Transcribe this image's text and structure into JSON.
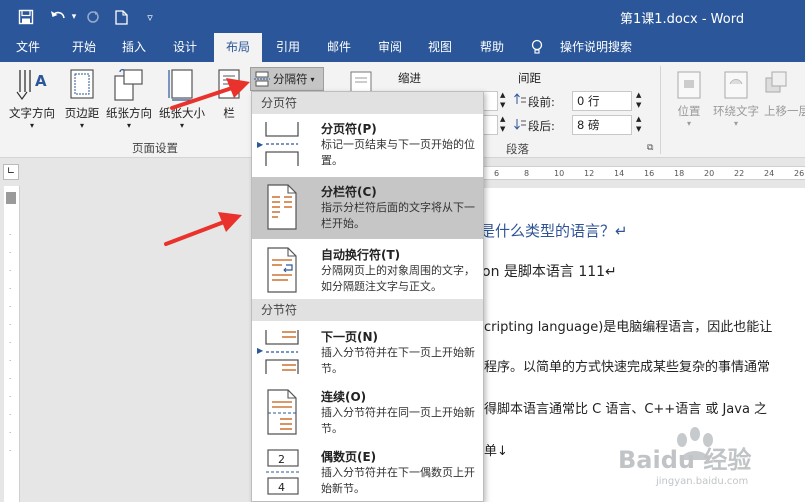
{
  "window": {
    "title": "第1课1.docx - Word"
  },
  "tabs": [
    "文件",
    "开始",
    "插入",
    "设计",
    "布局",
    "引用",
    "邮件",
    "审阅",
    "视图",
    "帮助",
    "操作说明搜索"
  ],
  "ribbon": {
    "page_setup": {
      "text_direction": "文字方向",
      "margins": "页边距",
      "orientation": "纸张方向",
      "size": "纸张大小",
      "columns": "栏",
      "group_label": "页面设置"
    },
    "breaks_button": "分隔符",
    "indent_label": "缩进",
    "spacing_label": "间距",
    "spacing_before_label": "段前:",
    "spacing_before_value": "0 行",
    "spacing_after_label": "段后:",
    "spacing_after_value": "8 磅",
    "paragraph_group_label": "段落",
    "arrange": {
      "position": "位置",
      "wrap_text": "环绕文字",
      "bring_forward": "上移一层"
    }
  },
  "dropdown": {
    "page_breaks_header": "分页符",
    "section_breaks_header": "分节符",
    "items": [
      {
        "title": "分页符(P)",
        "desc": "标记一页结束与下一页开始的位置。"
      },
      {
        "title": "分栏符(C)",
        "desc": "指示分栏符后面的文字将从下一栏开始。"
      },
      {
        "title": "自动换行符(T)",
        "desc": "分隔网页上的对象周围的文字，如分隔题注文字与正文。"
      },
      {
        "title": "下一页(N)",
        "desc": "插入分节符并在下一页上开始新节。"
      },
      {
        "title": "连续(O)",
        "desc": "插入分节符并在同一页上开始新节。"
      },
      {
        "title": "偶数页(E)",
        "desc": "插入分节符并在下一偶数页上开始新节。"
      }
    ]
  },
  "document": {
    "lines": [
      "是什么类型的语言？↵",
      "on 是脚本语言 111↵",
      "cripting language)是电脑编程语言，因此也能让",
      "程序。以简单的方式快速完成某些复杂的事情通常",
      "得脚本语言通常比 C 语言、C++语言 或 Java 之",
      "单↓"
    ]
  },
  "ruler": {
    "numbers": [
      "6",
      "8",
      "10",
      "12",
      "14",
      "16",
      "18",
      "20",
      "22",
      "24",
      "26"
    ]
  },
  "watermark": {
    "brand": "Baidu 经验",
    "url": "jingyan.baidu.com"
  },
  "colors": {
    "accent": "#2b579a",
    "arrow": "#e8322b"
  }
}
